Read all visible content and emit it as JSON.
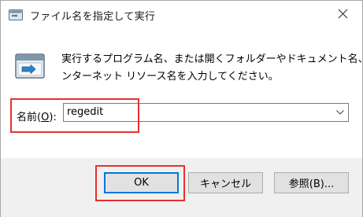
{
  "window": {
    "title": "ファイル名を指定して実行"
  },
  "description": {
    "line1": "実行するプログラム名、または開くフォルダーやドキュメント名、イ",
    "line2": "ンターネット リソース名を入力してください。"
  },
  "field": {
    "label_prefix": "名前(",
    "label_accel": "O",
    "label_suffix": "):",
    "value": "regedit"
  },
  "buttons": {
    "ok": "OK",
    "cancel": "キャンセル",
    "browse": "参照(B)..."
  },
  "colors": {
    "highlight": "#e8302f",
    "footer_bg": "#f0f0f0",
    "button_bg": "#e1e1e1",
    "default_border": "#0078d7"
  },
  "icons": {
    "title": "run-dialog-icon",
    "body": "run-dialog-icon",
    "close": "close-icon",
    "dropdown": "chevron-down-icon"
  }
}
